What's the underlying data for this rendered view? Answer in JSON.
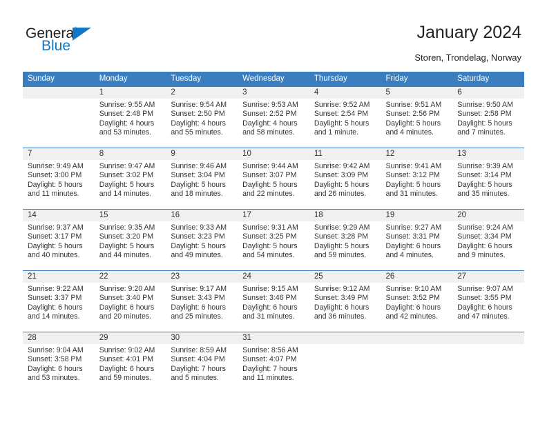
{
  "brand": {
    "name_part1": "General",
    "name_part2": "Blue",
    "accent_color": "#1277c4"
  },
  "header": {
    "title": "January 2024",
    "subtitle": "Storen, Trondelag, Norway",
    "header_bg_color": "#3a7ebf",
    "daynum_bg_color": "#f0f0f0"
  },
  "calendar": {
    "weekday_headers": [
      "Sunday",
      "Monday",
      "Tuesday",
      "Wednesday",
      "Thursday",
      "Friday",
      "Saturday"
    ],
    "weeks": [
      [
        {
          "day": "",
          "sunrise": "",
          "sunset": "",
          "daylight_line1": "",
          "daylight_line2": ""
        },
        {
          "day": "1",
          "sunrise": "Sunrise: 9:55 AM",
          "sunset": "Sunset: 2:48 PM",
          "daylight_line1": "Daylight: 4 hours",
          "daylight_line2": "and 53 minutes."
        },
        {
          "day": "2",
          "sunrise": "Sunrise: 9:54 AM",
          "sunset": "Sunset: 2:50 PM",
          "daylight_line1": "Daylight: 4 hours",
          "daylight_line2": "and 55 minutes."
        },
        {
          "day": "3",
          "sunrise": "Sunrise: 9:53 AM",
          "sunset": "Sunset: 2:52 PM",
          "daylight_line1": "Daylight: 4 hours",
          "daylight_line2": "and 58 minutes."
        },
        {
          "day": "4",
          "sunrise": "Sunrise: 9:52 AM",
          "sunset": "Sunset: 2:54 PM",
          "daylight_line1": "Daylight: 5 hours",
          "daylight_line2": "and 1 minute."
        },
        {
          "day": "5",
          "sunrise": "Sunrise: 9:51 AM",
          "sunset": "Sunset: 2:56 PM",
          "daylight_line1": "Daylight: 5 hours",
          "daylight_line2": "and 4 minutes."
        },
        {
          "day": "6",
          "sunrise": "Sunrise: 9:50 AM",
          "sunset": "Sunset: 2:58 PM",
          "daylight_line1": "Daylight: 5 hours",
          "daylight_line2": "and 7 minutes."
        }
      ],
      [
        {
          "day": "7",
          "sunrise": "Sunrise: 9:49 AM",
          "sunset": "Sunset: 3:00 PM",
          "daylight_line1": "Daylight: 5 hours",
          "daylight_line2": "and 11 minutes."
        },
        {
          "day": "8",
          "sunrise": "Sunrise: 9:47 AM",
          "sunset": "Sunset: 3:02 PM",
          "daylight_line1": "Daylight: 5 hours",
          "daylight_line2": "and 14 minutes."
        },
        {
          "day": "9",
          "sunrise": "Sunrise: 9:46 AM",
          "sunset": "Sunset: 3:04 PM",
          "daylight_line1": "Daylight: 5 hours",
          "daylight_line2": "and 18 minutes."
        },
        {
          "day": "10",
          "sunrise": "Sunrise: 9:44 AM",
          "sunset": "Sunset: 3:07 PM",
          "daylight_line1": "Daylight: 5 hours",
          "daylight_line2": "and 22 minutes."
        },
        {
          "day": "11",
          "sunrise": "Sunrise: 9:42 AM",
          "sunset": "Sunset: 3:09 PM",
          "daylight_line1": "Daylight: 5 hours",
          "daylight_line2": "and 26 minutes."
        },
        {
          "day": "12",
          "sunrise": "Sunrise: 9:41 AM",
          "sunset": "Sunset: 3:12 PM",
          "daylight_line1": "Daylight: 5 hours",
          "daylight_line2": "and 31 minutes."
        },
        {
          "day": "13",
          "sunrise": "Sunrise: 9:39 AM",
          "sunset": "Sunset: 3:14 PM",
          "daylight_line1": "Daylight: 5 hours",
          "daylight_line2": "and 35 minutes."
        }
      ],
      [
        {
          "day": "14",
          "sunrise": "Sunrise: 9:37 AM",
          "sunset": "Sunset: 3:17 PM",
          "daylight_line1": "Daylight: 5 hours",
          "daylight_line2": "and 40 minutes."
        },
        {
          "day": "15",
          "sunrise": "Sunrise: 9:35 AM",
          "sunset": "Sunset: 3:20 PM",
          "daylight_line1": "Daylight: 5 hours",
          "daylight_line2": "and 44 minutes."
        },
        {
          "day": "16",
          "sunrise": "Sunrise: 9:33 AM",
          "sunset": "Sunset: 3:23 PM",
          "daylight_line1": "Daylight: 5 hours",
          "daylight_line2": "and 49 minutes."
        },
        {
          "day": "17",
          "sunrise": "Sunrise: 9:31 AM",
          "sunset": "Sunset: 3:25 PM",
          "daylight_line1": "Daylight: 5 hours",
          "daylight_line2": "and 54 minutes."
        },
        {
          "day": "18",
          "sunrise": "Sunrise: 9:29 AM",
          "sunset": "Sunset: 3:28 PM",
          "daylight_line1": "Daylight: 5 hours",
          "daylight_line2": "and 59 minutes."
        },
        {
          "day": "19",
          "sunrise": "Sunrise: 9:27 AM",
          "sunset": "Sunset: 3:31 PM",
          "daylight_line1": "Daylight: 6 hours",
          "daylight_line2": "and 4 minutes."
        },
        {
          "day": "20",
          "sunrise": "Sunrise: 9:24 AM",
          "sunset": "Sunset: 3:34 PM",
          "daylight_line1": "Daylight: 6 hours",
          "daylight_line2": "and 9 minutes."
        }
      ],
      [
        {
          "day": "21",
          "sunrise": "Sunrise: 9:22 AM",
          "sunset": "Sunset: 3:37 PM",
          "daylight_line1": "Daylight: 6 hours",
          "daylight_line2": "and 14 minutes."
        },
        {
          "day": "22",
          "sunrise": "Sunrise: 9:20 AM",
          "sunset": "Sunset: 3:40 PM",
          "daylight_line1": "Daylight: 6 hours",
          "daylight_line2": "and 20 minutes."
        },
        {
          "day": "23",
          "sunrise": "Sunrise: 9:17 AM",
          "sunset": "Sunset: 3:43 PM",
          "daylight_line1": "Daylight: 6 hours",
          "daylight_line2": "and 25 minutes."
        },
        {
          "day": "24",
          "sunrise": "Sunrise: 9:15 AM",
          "sunset": "Sunset: 3:46 PM",
          "daylight_line1": "Daylight: 6 hours",
          "daylight_line2": "and 31 minutes."
        },
        {
          "day": "25",
          "sunrise": "Sunrise: 9:12 AM",
          "sunset": "Sunset: 3:49 PM",
          "daylight_line1": "Daylight: 6 hours",
          "daylight_line2": "and 36 minutes."
        },
        {
          "day": "26",
          "sunrise": "Sunrise: 9:10 AM",
          "sunset": "Sunset: 3:52 PM",
          "daylight_line1": "Daylight: 6 hours",
          "daylight_line2": "and 42 minutes."
        },
        {
          "day": "27",
          "sunrise": "Sunrise: 9:07 AM",
          "sunset": "Sunset: 3:55 PM",
          "daylight_line1": "Daylight: 6 hours",
          "daylight_line2": "and 47 minutes."
        }
      ],
      [
        {
          "day": "28",
          "sunrise": "Sunrise: 9:04 AM",
          "sunset": "Sunset: 3:58 PM",
          "daylight_line1": "Daylight: 6 hours",
          "daylight_line2": "and 53 minutes."
        },
        {
          "day": "29",
          "sunrise": "Sunrise: 9:02 AM",
          "sunset": "Sunset: 4:01 PM",
          "daylight_line1": "Daylight: 6 hours",
          "daylight_line2": "and 59 minutes."
        },
        {
          "day": "30",
          "sunrise": "Sunrise: 8:59 AM",
          "sunset": "Sunset: 4:04 PM",
          "daylight_line1": "Daylight: 7 hours",
          "daylight_line2": "and 5 minutes."
        },
        {
          "day": "31",
          "sunrise": "Sunrise: 8:56 AM",
          "sunset": "Sunset: 4:07 PM",
          "daylight_line1": "Daylight: 7 hours",
          "daylight_line2": "and 11 minutes."
        },
        {
          "day": "",
          "sunrise": "",
          "sunset": "",
          "daylight_line1": "",
          "daylight_line2": ""
        },
        {
          "day": "",
          "sunrise": "",
          "sunset": "",
          "daylight_line1": "",
          "daylight_line2": ""
        },
        {
          "day": "",
          "sunrise": "",
          "sunset": "",
          "daylight_line1": "",
          "daylight_line2": ""
        }
      ]
    ]
  }
}
